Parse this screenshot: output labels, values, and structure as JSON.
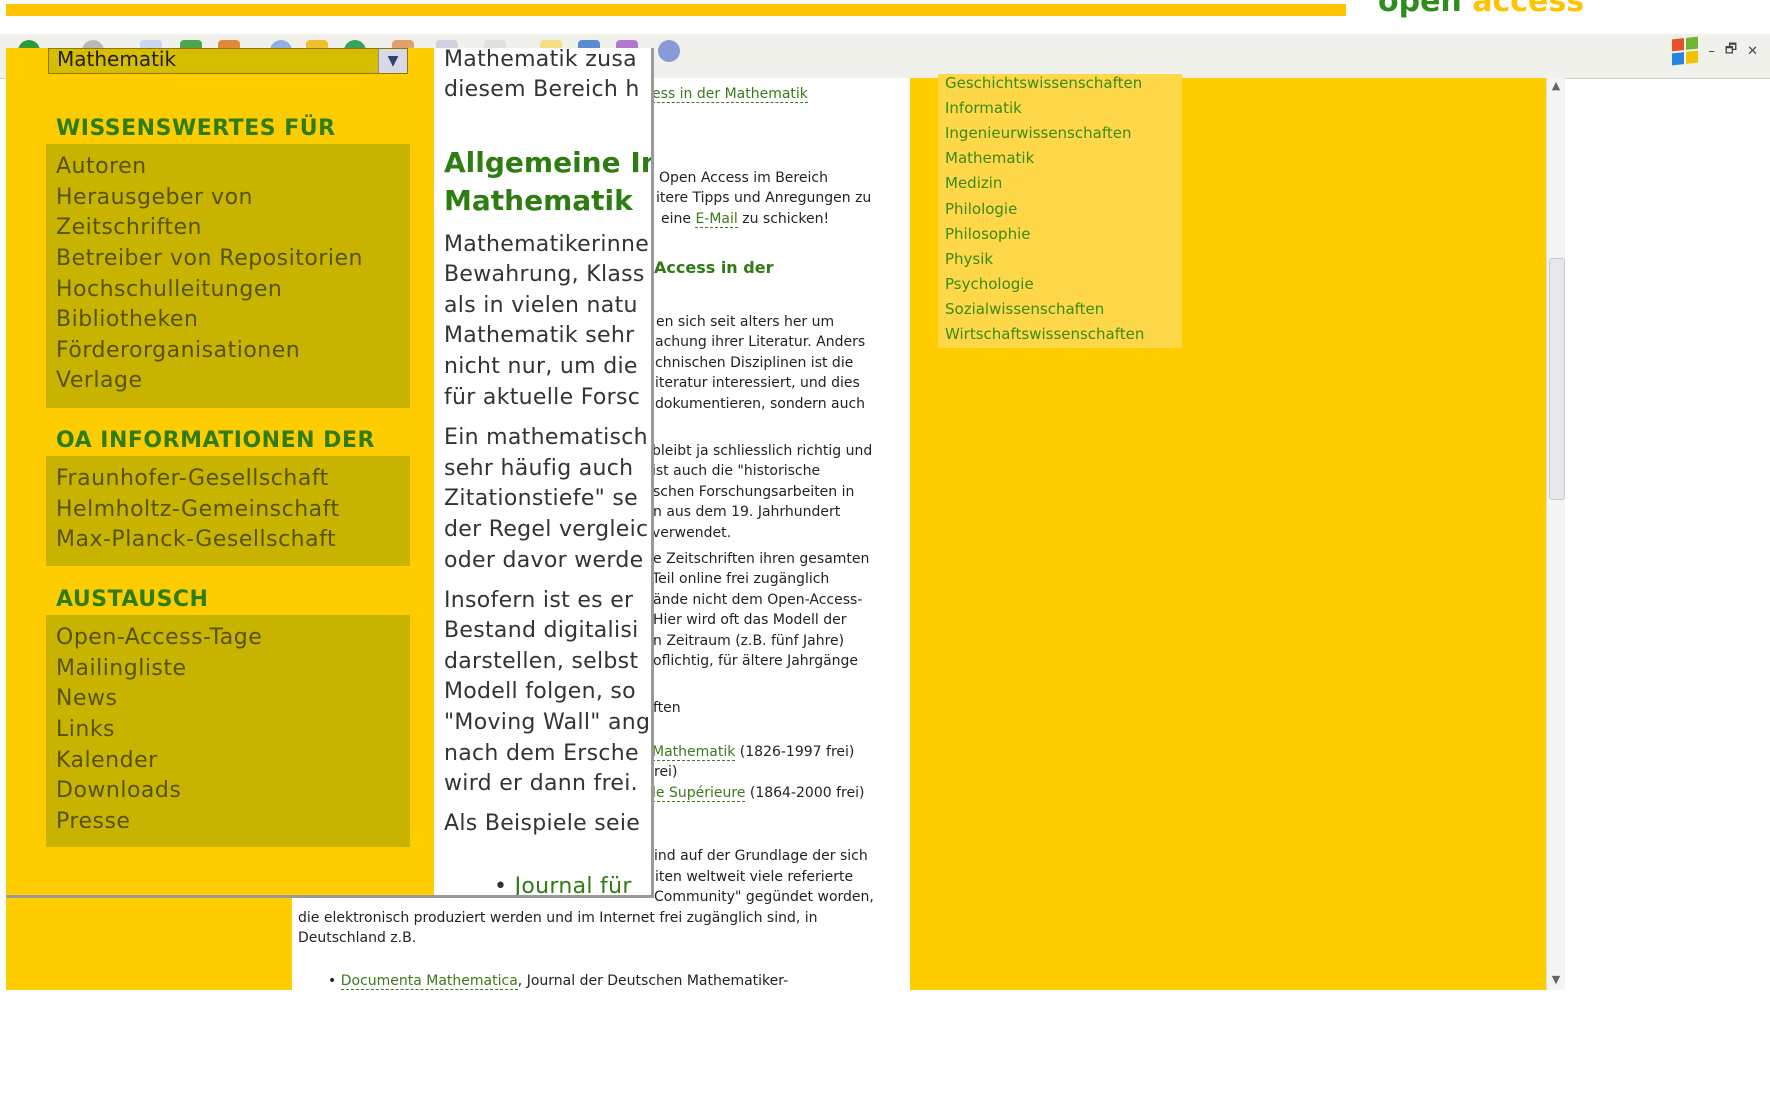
{
  "colors": {
    "page_bg": "#ffcc00",
    "link_green": "#3a7a1a",
    "nav_box": "#c8b400",
    "subject_bg": "#ffd84a"
  },
  "brand": {
    "part1": "open",
    "part2": "access"
  },
  "window_controls": {
    "minimize": "–",
    "restore": "🗗",
    "close": "✕"
  },
  "subjects": [
    "Geschichtswissenschaften",
    "Informatik",
    "Ingenieurwissenschaften",
    "Mathematik",
    "Medizin",
    "Philologie",
    "Philosophie",
    "Physik",
    "Psychologie",
    "Sozialwissenschaften",
    "Wirtschaftswissenschaften"
  ],
  "content": {
    "link_top": "ess in der Mathematik",
    "intro1": "Open Access im Bereich",
    "intro2": "itere Tipps und Anregungen zu",
    "intro3_pre": "eine ",
    "intro3_link": "E-Mail",
    "intro3_post": " zu schicken!",
    "heading": "Access in der",
    "p1": [
      "en sich seit alters her um",
      "achung ihrer Literatur. Anders",
      "chnischen Disziplinen ist die",
      "iteratur interessiert, und dies",
      "dokumentieren, sondern auch"
    ],
    "p2": [
      "bleibt ja schliesslich richtig und",
      "ist auch die \"historische",
      "schen Forschungsarbeiten in",
      "n aus dem 19. Jahrhundert",
      "verwendet."
    ],
    "p3": [
      "e Zeitschriften ihren gesamten",
      "Teil online frei zugänglich",
      "ände nicht dem Open-Access-",
      "Hier wird oft das Modell der",
      "n Zeitraum (z.B. fünf Jahre)",
      "oflichtig, für ältere Jahrgänge"
    ],
    "p4": "ften",
    "item1_link": "Mathematik",
    "item1_rest": " (1826-1997 frei)",
    "item1_b": "rei)",
    "item2_link": "le Supérieure",
    "item2_rest": " (1864-2000 frei)",
    "p5": [
      "ind auf der Grundlage der sich",
      "iten weltweit viele referierte",
      "Community\" gegündet worden,"
    ],
    "p6": [
      "die elektronisch produziert werden und im Internet frei zugänglich sind, in",
      "Deutschland z.B."
    ],
    "bottom_link": "Documenta Mathematica",
    "bottom_rest": ", Journal der Deutschen Mathematiker-"
  },
  "popup": {
    "select_value": "Mathematik",
    "sections": [
      {
        "title": "WISSENSWERTES FÜR",
        "items": [
          "Autoren",
          "Herausgeber von",
          "Zeitschriften",
          "Betreiber von Repositorien",
          "Hochschulleitungen",
          "Bibliotheken",
          "Förderorganisationen",
          "Verlage"
        ]
      },
      {
        "title": "OA INFORMATIONEN DER",
        "items": [
          "Fraunhofer-Gesellschaft",
          "Helmholtz-Gemeinschaft",
          "Max-Planck-Gesellschaft"
        ]
      },
      {
        "title": "AUSTAUSCH",
        "items": [
          "Open-Access-Tage",
          "Mailingliste",
          "News",
          "Links",
          "Kalender",
          "Downloads",
          "Presse"
        ]
      }
    ],
    "page_lines": {
      "l1": "Mathematik zusa",
      "l2": "diesem Bereich h",
      "h1": "Allgemeine In",
      "h2": "Mathematik",
      "body": [
        "Mathematikerinne",
        "Bewahrung, Klass",
        "als in vielen natu",
        "Mathematik sehr",
        "nicht nur, um die",
        "für aktuelle Forsc"
      ],
      "body2": [
        "Ein mathematisch",
        "sehr häufig auch",
        "Zitationstiefe\" se",
        "der Regel vergleic",
        "oder davor werde"
      ],
      "body3": [
        "Insofern ist es er",
        "Bestand digitalisi",
        "darstellen, selbst",
        "Modell folgen, so",
        "\"Moving Wall\" ang",
        "nach dem Ersche",
        "wird er dann frei."
      ],
      "body4": "Als Beispiele seie",
      "bullet": "Journal für"
    }
  }
}
